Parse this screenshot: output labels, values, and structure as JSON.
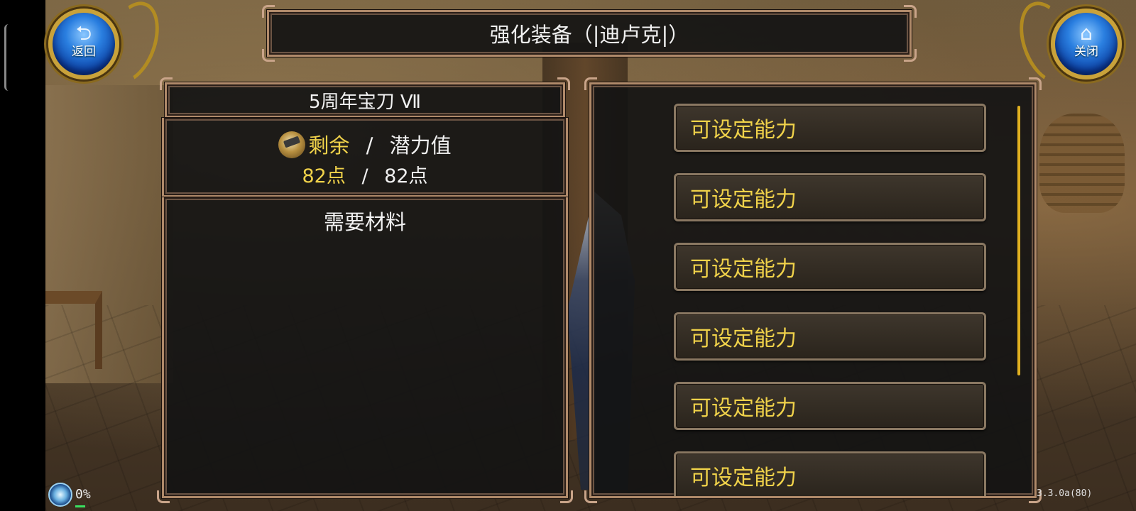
{
  "window": {
    "title": "强化装备（|迪卢克|）"
  },
  "nav": {
    "back_label": "返回",
    "back_icon": "return-arrow-icon",
    "close_label": "关闭",
    "close_icon": "home-icon"
  },
  "item": {
    "name": "5周年宝刀 Ⅶ",
    "remaining_label": "剩余",
    "separator": "/",
    "potential_label": "潜力值",
    "remaining_points": "82点",
    "potential_points": "82点",
    "materials_label": "需要材料"
  },
  "abilities": [
    {
      "label": "可设定能力"
    },
    {
      "label": "可设定能力"
    },
    {
      "label": "可设定能力"
    },
    {
      "label": "可设定能力"
    },
    {
      "label": "可设定能力"
    },
    {
      "label": "可设定能力"
    }
  ],
  "status": {
    "loading_percent": "0%",
    "version": "3.3.0a(80)"
  },
  "colors": {
    "accent_gold": "#f0d24a",
    "frame": "#b08a6a",
    "button_blue": "#2a7fe0"
  }
}
